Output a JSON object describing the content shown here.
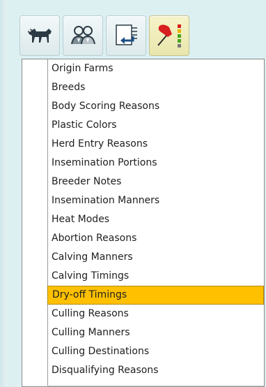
{
  "toolbar": {
    "buttons": [
      {
        "icon": "cow-icon"
      },
      {
        "icon": "people-icon"
      },
      {
        "icon": "import-list-icon"
      },
      {
        "icon": "pushpin-icon",
        "active": true
      }
    ]
  },
  "list": {
    "selected_index": 12,
    "items": [
      "Origin Farms",
      "Breeds",
      "Body Scoring Reasons",
      "Plastic Colors",
      "Herd Entry Reasons",
      "Insemination Portions",
      "Breeder Notes",
      "Insemination Manners",
      "Heat Modes",
      "Abortion Reasons",
      "Calving Manners",
      "Calving Timings",
      "Dry-off Timings",
      "Culling Reasons",
      "Culling Manners",
      "Culling Destinations",
      "Disqualifying Reasons"
    ]
  },
  "colors": {
    "selection": "#ffc000",
    "panel": "#dcf0f2"
  }
}
